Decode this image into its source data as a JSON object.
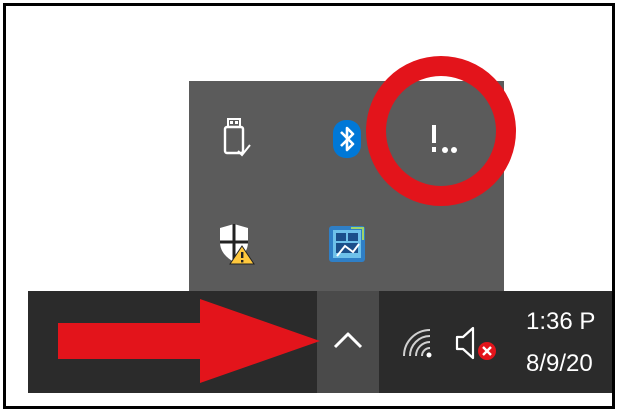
{
  "tray_overflow": {
    "icons": [
      {
        "id": "usb-eject",
        "icon": "usb-drive-icon"
      },
      {
        "id": "bluetooth",
        "icon": "bluetooth-icon"
      },
      {
        "id": "exclamation-dots",
        "icon": "exclamation-dots-icon",
        "text": "!.."
      },
      {
        "id": "windows-security",
        "icon": "shield-warning-icon"
      },
      {
        "id": "intel-graphics",
        "icon": "intel-graphics-icon"
      }
    ]
  },
  "taskbar": {
    "chevron_icon": "chevron-up-icon",
    "network_icon": "wifi-icon",
    "volume_icon": "volume-muted-icon",
    "clock": {
      "time": "1:36 P",
      "date": "8/9/20"
    }
  },
  "annotations": {
    "circle_color": "#e3141b",
    "arrow_color": "#e3141b"
  },
  "colors": {
    "panel_bg": "#5b5b5b",
    "taskbar_bg": "#2b2b2b",
    "chevron_bg": "#4a4a4a",
    "bluetooth_blue": "#0078d7",
    "warning_yellow": "#ffc83d"
  }
}
